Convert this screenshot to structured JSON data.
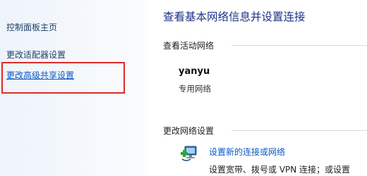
{
  "sidebar": {
    "home_label": "控制面板主页",
    "adapter_label": "更改适配器设置",
    "sharing_label": "更改高级共享设置"
  },
  "main": {
    "title": "查看基本网络信息并设置连接",
    "active_networks_label": "查看活动网络",
    "network": {
      "name": "yanyu",
      "type": "专用网络"
    },
    "change_settings_label": "更改网络设置",
    "setup_connection": {
      "icon": "network-setup-icon",
      "link_label": "设置新的连接或网络",
      "description": "设置宽带、拨号或 VPN 连接；或设置"
    }
  },
  "colors": {
    "link": "#0a57c2",
    "title": "#1e3287",
    "highlight": "#e02a2a",
    "sidebar_bg": "#eef4fb"
  }
}
